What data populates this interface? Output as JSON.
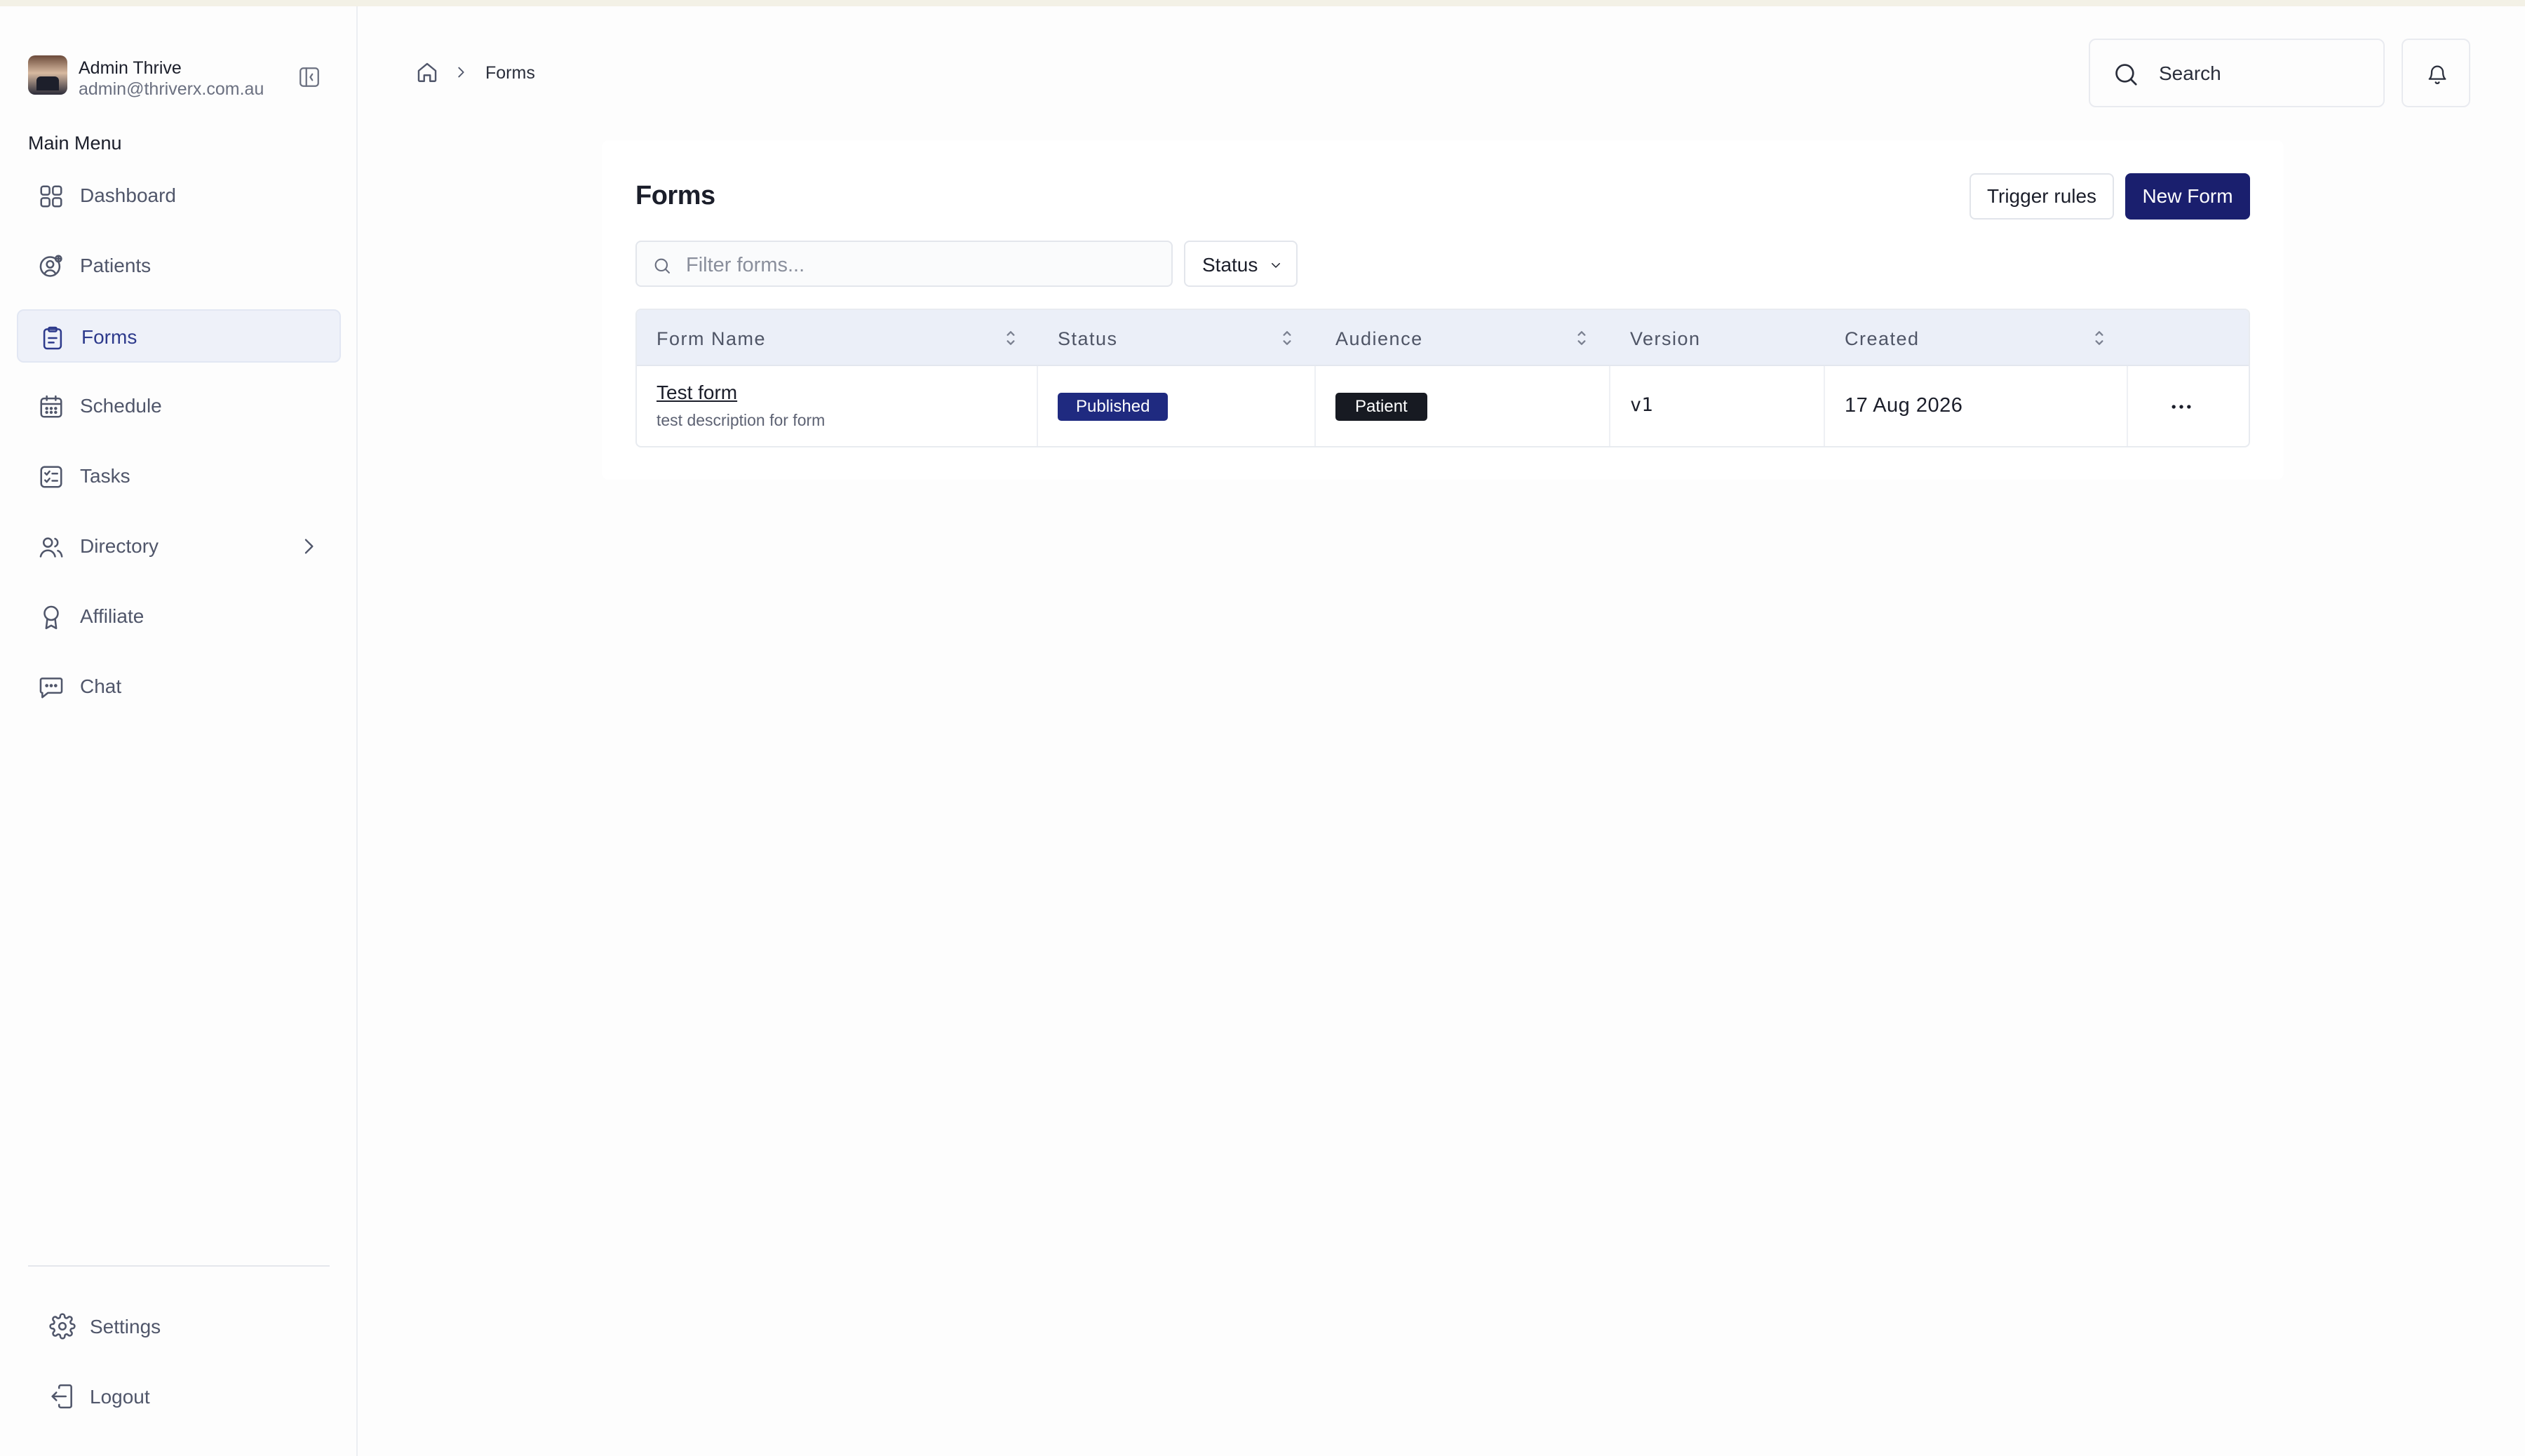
{
  "profile": {
    "name": "Admin Thrive",
    "email": "admin@thriverx.com.au"
  },
  "sidebar": {
    "menu_title": "Main Menu",
    "items": [
      {
        "label": "Dashboard",
        "icon": "grid-icon"
      },
      {
        "label": "Patients",
        "icon": "patients-icon"
      },
      {
        "label": "Forms",
        "icon": "clipboard-icon",
        "active": true
      },
      {
        "label": "Schedule",
        "icon": "calendar-icon"
      },
      {
        "label": "Tasks",
        "icon": "checklist-icon"
      },
      {
        "label": "Directory",
        "icon": "users-icon",
        "has_submenu": true
      },
      {
        "label": "Affiliate",
        "icon": "award-icon"
      },
      {
        "label": "Chat",
        "icon": "chat-icon"
      }
    ],
    "bottom": [
      {
        "label": "Settings",
        "icon": "gear-icon"
      },
      {
        "label": "Logout",
        "icon": "logout-icon"
      }
    ]
  },
  "header": {
    "breadcrumb": {
      "current": "Forms"
    },
    "search_placeholder": "Search"
  },
  "page": {
    "title": "Forms",
    "trigger_rules_label": "Trigger rules",
    "new_form_label": "New Form",
    "filter_placeholder": "Filter forms...",
    "status_filter_label": "Status"
  },
  "table": {
    "columns": [
      "Form Name",
      "Status",
      "Audience",
      "Version",
      "Created"
    ],
    "rows": [
      {
        "name": "Test form",
        "description": "test description for form",
        "status": "Published",
        "audience": "Patient",
        "version": "v1",
        "created": "17 Aug 2026"
      }
    ]
  },
  "colors": {
    "primary": "#1a1f6e",
    "published_badge": "#1f2a80",
    "patient_badge": "#171a22",
    "active_nav_bg": "#eef1f9",
    "table_header_bg": "#ebeff8"
  }
}
